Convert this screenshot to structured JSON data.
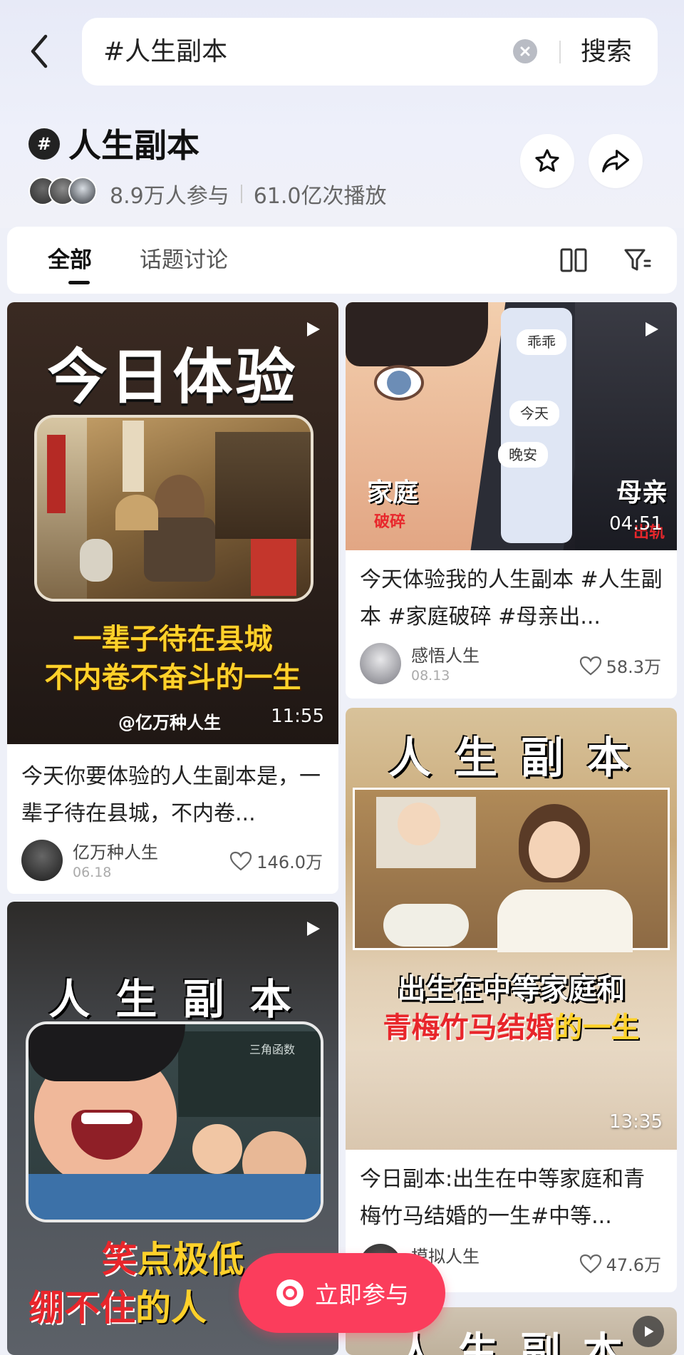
{
  "search": {
    "query": "#人生副本",
    "button_label": "搜索"
  },
  "topic": {
    "badge": "#",
    "title": "人生副本",
    "participants": "8.9万人参与",
    "plays": "61.0亿次播放"
  },
  "tabs": [
    {
      "label": "全部",
      "active": true
    },
    {
      "label": "话题讨论",
      "active": false
    }
  ],
  "cards": [
    {
      "cover_heading": "今日体验",
      "cover_caption_1": "一辈子待在县城",
      "cover_caption_2": "不内卷不奋斗的一生",
      "cover_watermark": "@亿万种人生",
      "duration": "11:55",
      "title": "今天你要体验的人生副本是，一辈子待在县城，不内卷...",
      "author": "亿万种人生",
      "date": "06.18",
      "likes": "146.0万"
    },
    {
      "cover_left": "家庭",
      "cover_left_red": "破碎",
      "cover_right": "母亲",
      "cover_right_red": "出轨",
      "bubble_1": "乖乖",
      "bubble_2": "今天",
      "bubble_3": "晚安",
      "duration": "04:51",
      "title": "今天体验我的人生副本 #人生副本 #家庭破碎 #母亲出...",
      "author": "感悟人生",
      "date": "08.13",
      "likes": "58.3万"
    },
    {
      "cover_heading": "人 生 副 本",
      "cover_caption_1": "出生在中等家庭和",
      "cover_caption_2a": "青梅竹马结婚",
      "cover_caption_2b": "的一生",
      "duration": "13:35",
      "title": "今日副本:出生在中等家庭和青梅竹马结婚的一生#中等...",
      "author": "模拟人生",
      "likes": "47.6万"
    },
    {
      "cover_heading": "人 生 副 本",
      "cover_board_text": "三角函数",
      "cover_caption_1a": "笑",
      "cover_caption_1b": "点极低",
      "cover_caption_2a": "绷不住",
      "cover_caption_2b": "的人"
    },
    {
      "cover_heading": "人 生 副 本"
    }
  ],
  "join_button": {
    "label": "立即参与"
  },
  "icons": [
    "back-icon",
    "clear-icon",
    "hashtag-icon",
    "star-icon",
    "share-icon",
    "dual-column-icon",
    "filter-icon",
    "play-icon",
    "heart-icon",
    "camera-icon"
  ],
  "colors": {
    "accent": "#fb3d5c",
    "background": "#eef0f8"
  }
}
